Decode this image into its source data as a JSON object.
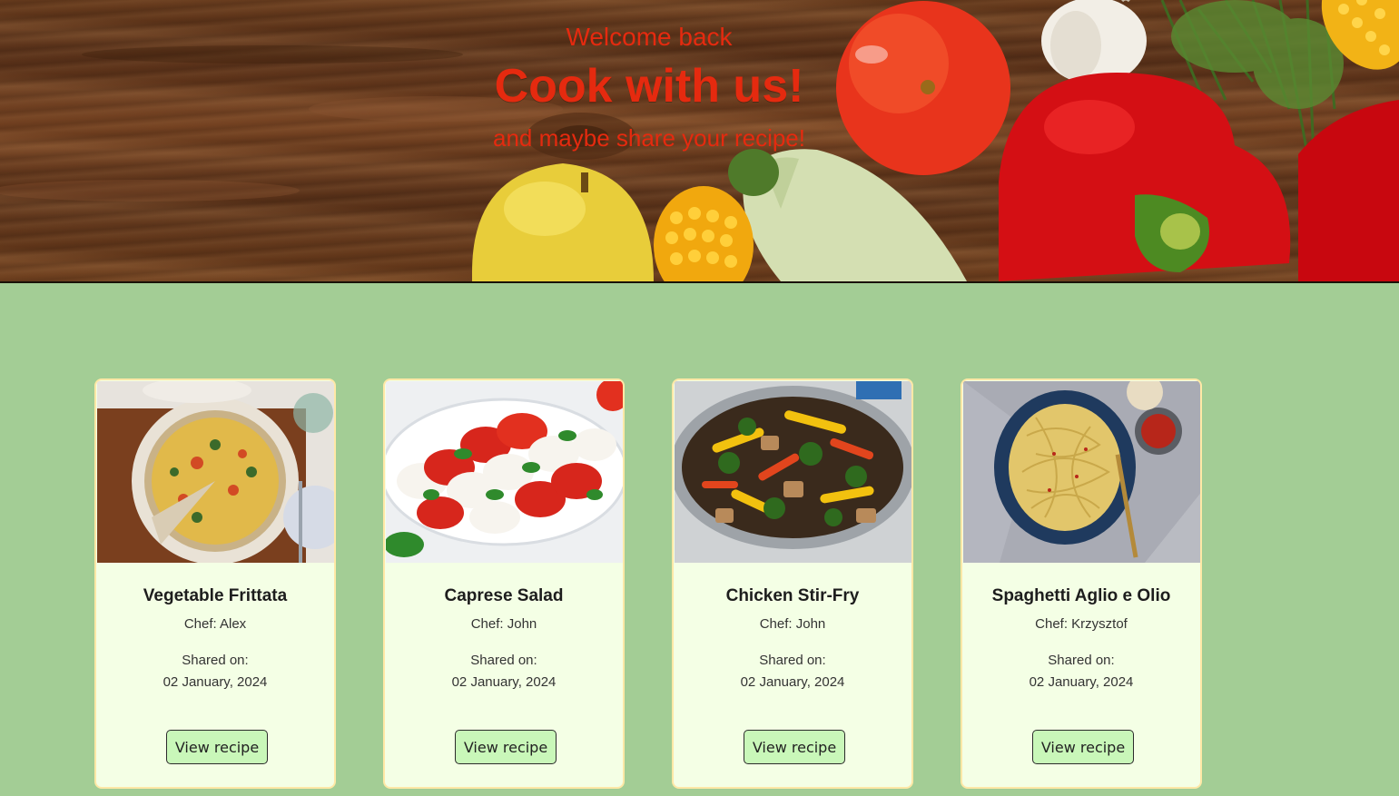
{
  "hero": {
    "welcome": "Welcome back",
    "title": "Cook with us!",
    "subtitle": "and maybe share your recipe!",
    "text_color": "#e52a0f"
  },
  "page": {
    "background": "#a3cd95"
  },
  "recipes": [
    {
      "title": "Vegetable Frittata",
      "chef": "Chef: Alex",
      "shared_label": "Shared on:",
      "date": "02 January, 2024",
      "button": "View recipe",
      "image": "vegetable-frittata-photo"
    },
    {
      "title": "Caprese Salad",
      "chef": "Chef: John",
      "shared_label": "Shared on:",
      "date": "02 January, 2024",
      "button": "View recipe",
      "image": "caprese-salad-photo"
    },
    {
      "title": "Chicken Stir-Fry",
      "chef": "Chef: John",
      "shared_label": "Shared on:",
      "date": "02 January, 2024",
      "button": "View recipe",
      "image": "chicken-stir-fry-photo"
    },
    {
      "title": "Spaghetti Aglio e Olio",
      "chef": "Chef: Krzysztof",
      "shared_label": "Shared on:",
      "date": "02 January, 2024",
      "button": "View recipe",
      "image": "spaghetti-aglio-olio-photo"
    }
  ],
  "colors": {
    "card_background": "#f4ffe5",
    "card_border": "#ffe8a6",
    "button_background": "#c9f7b9"
  }
}
